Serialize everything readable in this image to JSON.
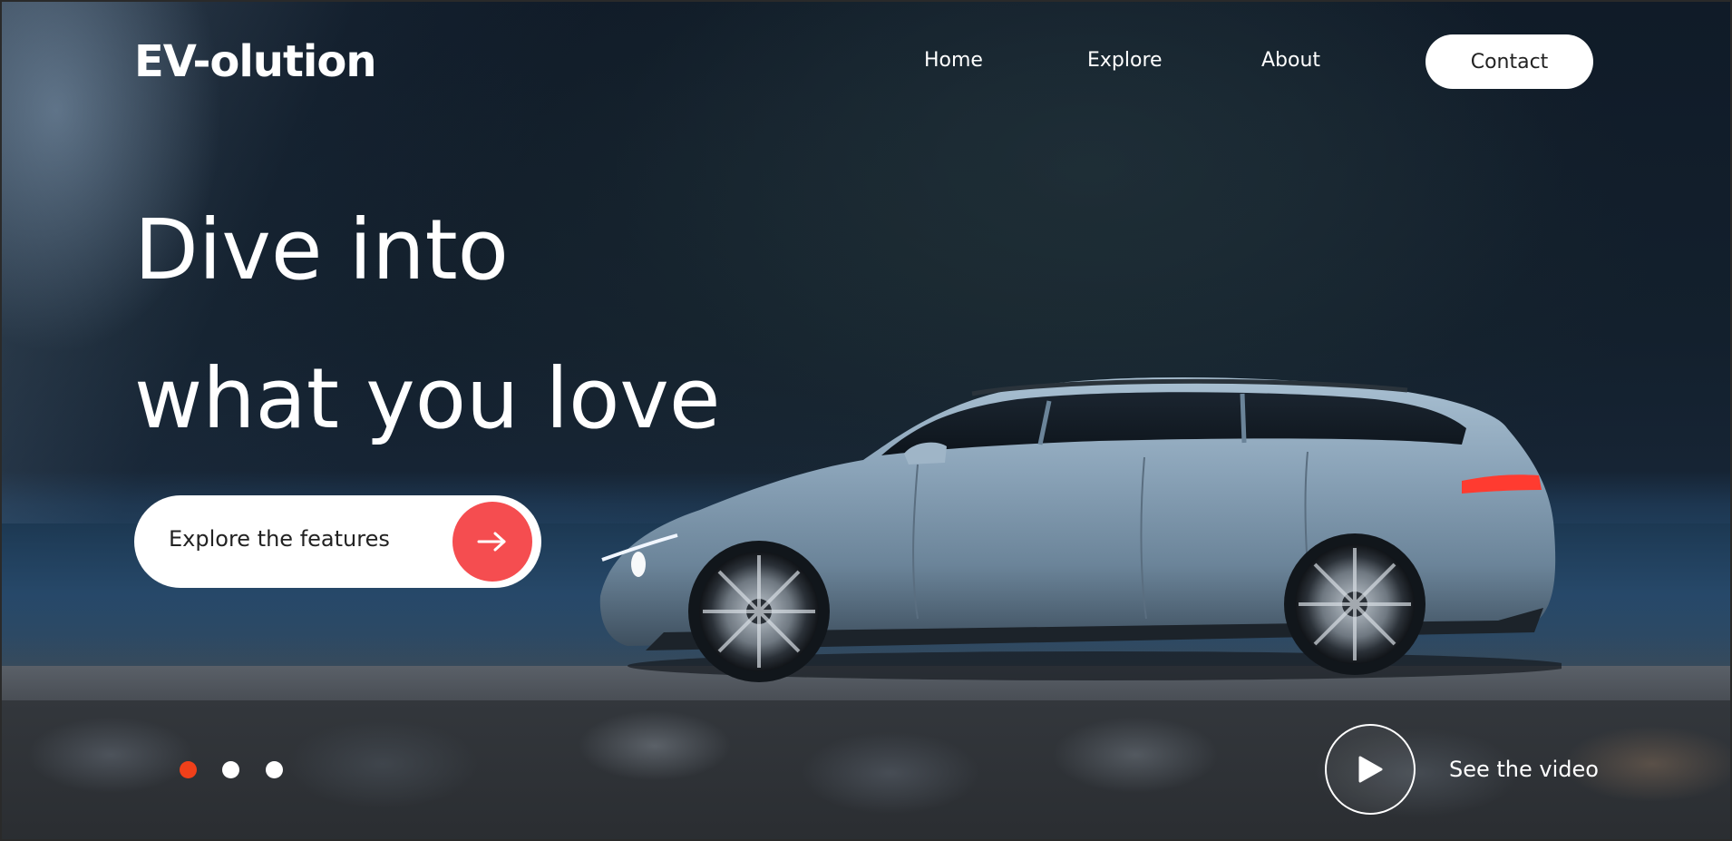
{
  "header": {
    "logo": "EV-olution",
    "nav": {
      "home": "Home",
      "explore": "Explore",
      "about": "About",
      "contact": "Contact"
    }
  },
  "hero": {
    "headline_line1": "Dive into",
    "headline_line2": "what you love",
    "cta_label": "Explore the features",
    "cta_icon": "arrow-right-icon"
  },
  "slider": {
    "slide_count": 3,
    "active_index": 0
  },
  "video": {
    "label": "See the video",
    "icon": "play-icon"
  },
  "colors": {
    "accent_red": "#f54d50",
    "active_dot": "#f0401a",
    "text_light": "#ffffff",
    "text_dark": "#222222"
  }
}
